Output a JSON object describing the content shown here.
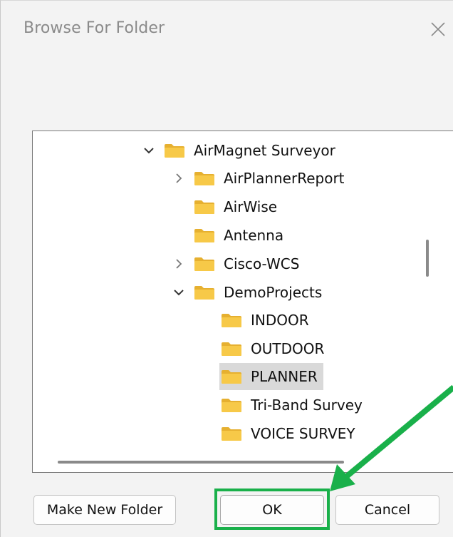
{
  "dialog": {
    "title": "Browse For Folder",
    "close_glyph": "×"
  },
  "tree": {
    "items": [
      {
        "label": "AirMagnet Surveyor",
        "expander": "expanded",
        "depth": 0
      },
      {
        "label": "AirPlannerReport",
        "expander": "collapsed",
        "depth": 1
      },
      {
        "label": "AirWise",
        "expander": "none",
        "depth": 1
      },
      {
        "label": "Antenna",
        "expander": "none",
        "depth": 1
      },
      {
        "label": "Cisco-WCS",
        "expander": "collapsed",
        "depth": 1
      },
      {
        "label": "DemoProjects",
        "expander": "expanded",
        "depth": 1
      },
      {
        "label": "INDOOR",
        "expander": "none",
        "depth": 2
      },
      {
        "label": "OUTDOOR",
        "expander": "none",
        "depth": 2
      },
      {
        "label": "PLANNER",
        "expander": "none",
        "depth": 2,
        "selected": true
      },
      {
        "label": "Tri-Band Survey",
        "expander": "none",
        "depth": 2
      },
      {
        "label": "VOICE SURVEY",
        "expander": "none",
        "depth": 2
      }
    ]
  },
  "buttons": {
    "new_folder": "Make New Folder",
    "ok": "OK",
    "cancel": "Cancel"
  },
  "colors": {
    "folder": "#f7c948",
    "folder_tab": "#e6b030",
    "annotation": "#19b04a",
    "selection": "#d9d9d9"
  },
  "icons": {
    "expanded": "chevron-down-icon",
    "collapsed": "chevron-right-icon",
    "folder": "folder-icon",
    "close": "close-icon"
  }
}
